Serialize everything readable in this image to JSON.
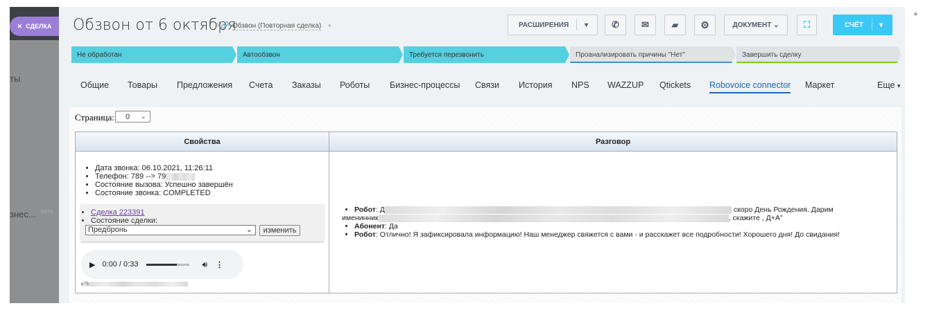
{
  "sidebar": {
    "close_label": "СДЕЛКА",
    "item_partial": "ты",
    "item2_partial": "знес...",
    "item2_badge": "beta"
  },
  "header": {
    "title": "Обзвон от 6  октября",
    "category": "Обзвон (Повторная сделка)"
  },
  "toolbar": {
    "extensions": "РАСШИРЕНИЯ",
    "document": "ДОКУМЕНТ",
    "invoice": "СЧЁТ"
  },
  "stages": [
    {
      "label": "Не обработан",
      "active": true
    },
    {
      "label": "Автообзвон",
      "active": true
    },
    {
      "label": "Требуется перезвонить",
      "active": true
    },
    {
      "label": "Проанализировать причины \"Нет\"",
      "active": false
    },
    {
      "label": "Завершить сделку",
      "active": false
    }
  ],
  "tabs": [
    "Общие",
    "Товары",
    "Предложения",
    "Счета",
    "Заказы",
    "Роботы",
    "Бизнес-процессы",
    "Связи",
    "История",
    "NPS",
    "WAZZUP",
    "Qtickets",
    "Robovoice connector",
    "Маркет"
  ],
  "tabs_more": "Еще",
  "active_tab": "Robovoice connector",
  "page_select": {
    "label": "Страница:",
    "value": "0"
  },
  "table": {
    "col_props": "Свойства",
    "col_talk": "Разговор",
    "props": [
      "Дата звонка: 06.10.2021, 11:26:11",
      "Телефон: 789 --> 79",
      "Состояние вызова: Успешно завершён",
      "Состояние звонка: COMPLETED"
    ],
    "deal_link": "Сделка 223391",
    "deal_state_label": "Состояние сделки:",
    "deal_state_value": "Предбронь",
    "change_button": "изменить",
    "audio_time": "0:00 / 0:33",
    "audio_progress": 0.7,
    "file_prefix": "e7b",
    "talk": [
      {
        "who": "Робот",
        "text_start": "Д",
        "text_end": "скоро День Рождения. Дарим",
        "line2_start": "именинник",
        "line2_end": ", скажите , Д+А\""
      },
      {
        "who": "Абонент",
        "text": "Да"
      },
      {
        "who": "Робот",
        "text": "Отлично! Я зафиксировала информацию! Наш менеджер свяжется с вами - и расскажет все подробности! Хорошего дня! До свидания!"
      }
    ]
  }
}
